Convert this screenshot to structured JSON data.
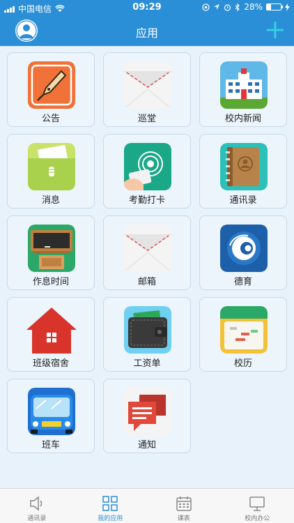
{
  "status_bar": {
    "carrier": "中国电信",
    "time": "09:29",
    "battery_percent": "28%",
    "battery_level": 0.28
  },
  "nav": {
    "title": "应用"
  },
  "apps": [
    {
      "label": "公告",
      "icon": "pen-nib-icon"
    },
    {
      "label": "巡堂",
      "icon": "envelope-icon"
    },
    {
      "label": "校内新闻",
      "icon": "school-building-icon"
    },
    {
      "label": "消息",
      "icon": "folder-message-icon"
    },
    {
      "label": "考勤打卡",
      "icon": "card-swipe-icon"
    },
    {
      "label": "通讯录",
      "icon": "address-book-icon"
    },
    {
      "label": "作息时间",
      "icon": "blackboard-icon"
    },
    {
      "label": "邮箱",
      "icon": "envelope-icon"
    },
    {
      "label": "德育",
      "icon": "moral-education-icon"
    },
    {
      "label": "班级宿舍",
      "icon": "house-icon"
    },
    {
      "label": "工资单",
      "icon": "wallet-icon"
    },
    {
      "label": "校历",
      "icon": "calendar-icon"
    },
    {
      "label": "班车",
      "icon": "bus-icon"
    },
    {
      "label": "通知",
      "icon": "chat-bubbles-icon"
    }
  ],
  "tabs": [
    {
      "label": "通讯录",
      "icon": "speaker-icon",
      "active": false
    },
    {
      "label": "我的应用",
      "icon": "grid-icon",
      "active": true
    },
    {
      "label": "课表",
      "icon": "timetable-icon",
      "active": false
    },
    {
      "label": "校内办公",
      "icon": "monitor-icon",
      "active": false
    }
  ],
  "colors": {
    "primary": "#2b8fd8",
    "add_button": "#32d0e0",
    "background": "#e8f2fb"
  }
}
